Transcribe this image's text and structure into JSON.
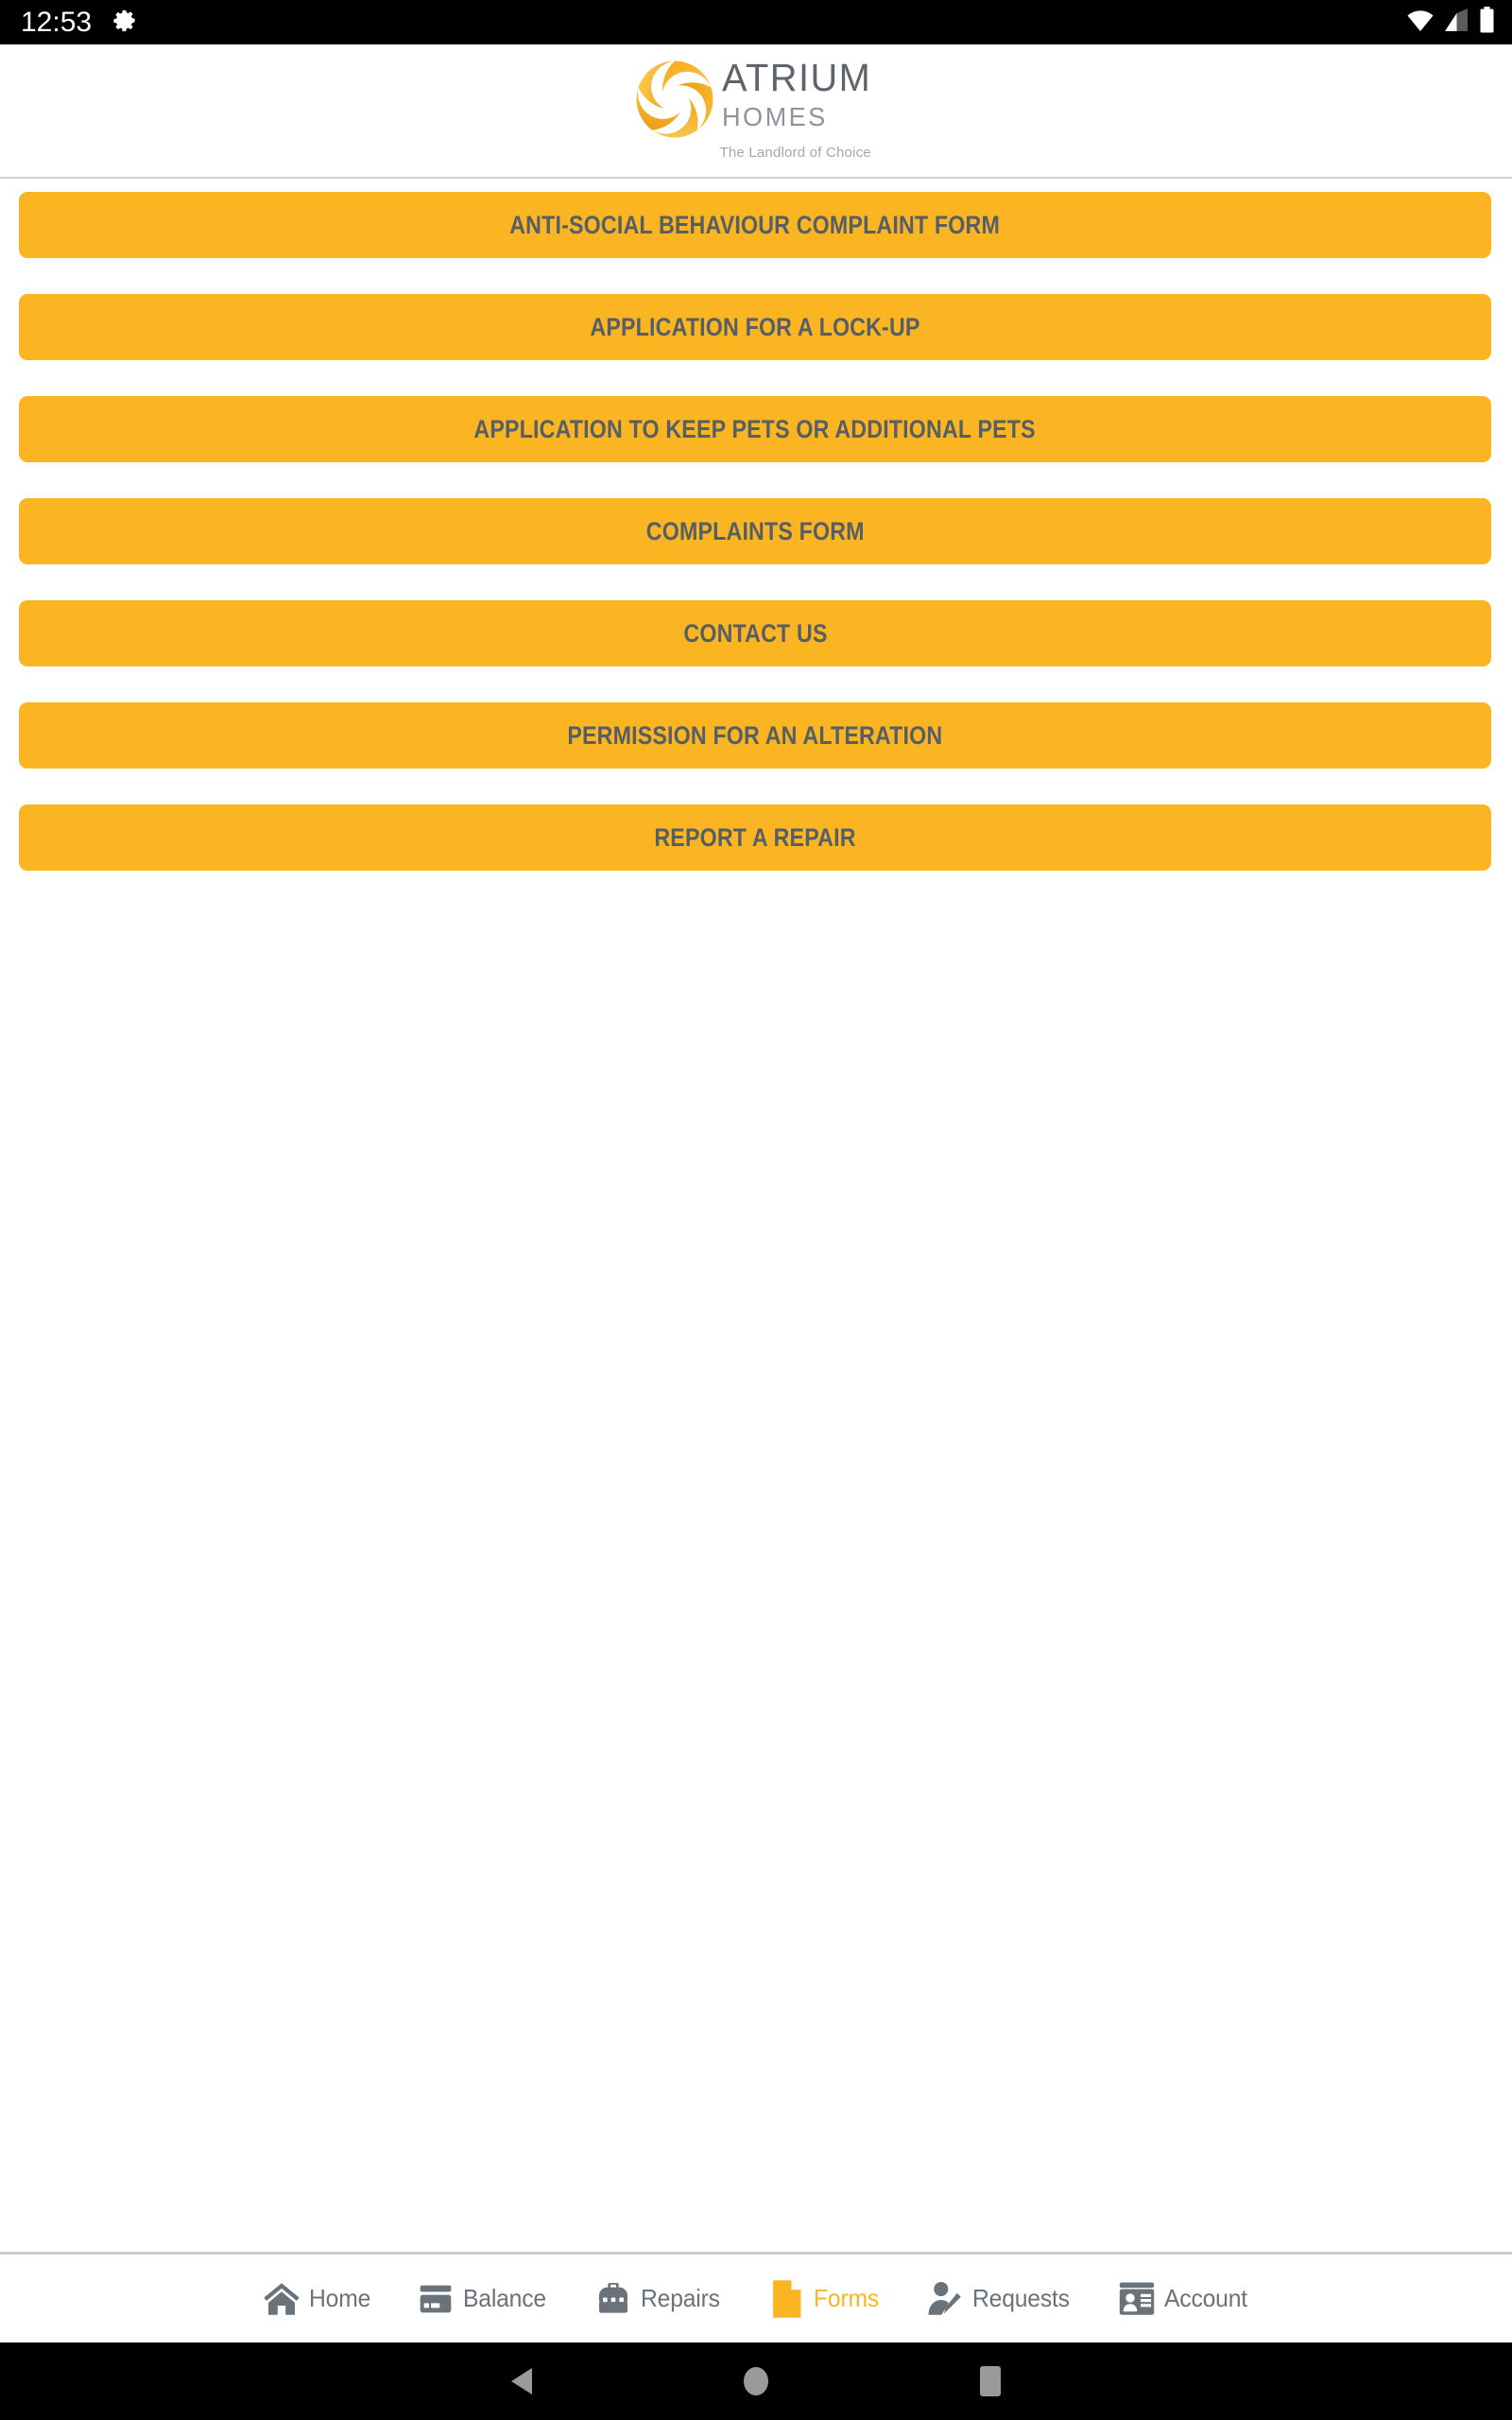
{
  "status_bar": {
    "clock": "12:53",
    "icons": [
      "settings-gear-icon",
      "wifi-icon",
      "cell-signal-icon",
      "battery-icon"
    ]
  },
  "header": {
    "logo": {
      "mark": "atrium-pentagon-swirl-logo",
      "brand_line1": "ATRIUM",
      "brand_line2": "HOMES",
      "tagline": "The Landlord of Choice"
    }
  },
  "main": {
    "form_buttons": [
      {
        "label": "Anti-Social Behaviour Complaint Form",
        "name": "anti-social-behaviour-complaint-form"
      },
      {
        "label": "Application for a Lock-Up",
        "name": "application-for-a-lock-up"
      },
      {
        "label": "Application to Keep Pets or Additional Pets",
        "name": "application-to-keep-pets-or-additional-pets"
      },
      {
        "label": "Complaints Form",
        "name": "complaints-form"
      },
      {
        "label": "Contact Us",
        "name": "contact-us"
      },
      {
        "label": "Permission for an Alteration",
        "name": "permission-for-an-alteration"
      },
      {
        "label": "Report a Repair",
        "name": "report-a-repair"
      }
    ]
  },
  "bottom_nav": {
    "items": [
      {
        "label": "Home",
        "icon": "house-icon",
        "active": false
      },
      {
        "label": "Balance",
        "icon": "credit-card-icon",
        "active": false
      },
      {
        "label": "Repairs",
        "icon": "toolbox-icon",
        "active": false
      },
      {
        "label": "Forms",
        "icon": "document-page-icon",
        "active": true
      },
      {
        "label": "Requests",
        "icon": "person-pencil-icon",
        "active": false
      },
      {
        "label": "Account",
        "icon": "id-card-icon",
        "active": false
      }
    ]
  },
  "system_nav": {
    "buttons": [
      "back-triangle-icon",
      "home-circle-icon",
      "recents-square-icon"
    ]
  },
  "colors": {
    "brand_orange": "#FBB522",
    "button_text": "#565E66",
    "nav_icon_gray": "#6A727A",
    "status_bar_bg": "#000000",
    "divider": "#CCCCCC"
  }
}
